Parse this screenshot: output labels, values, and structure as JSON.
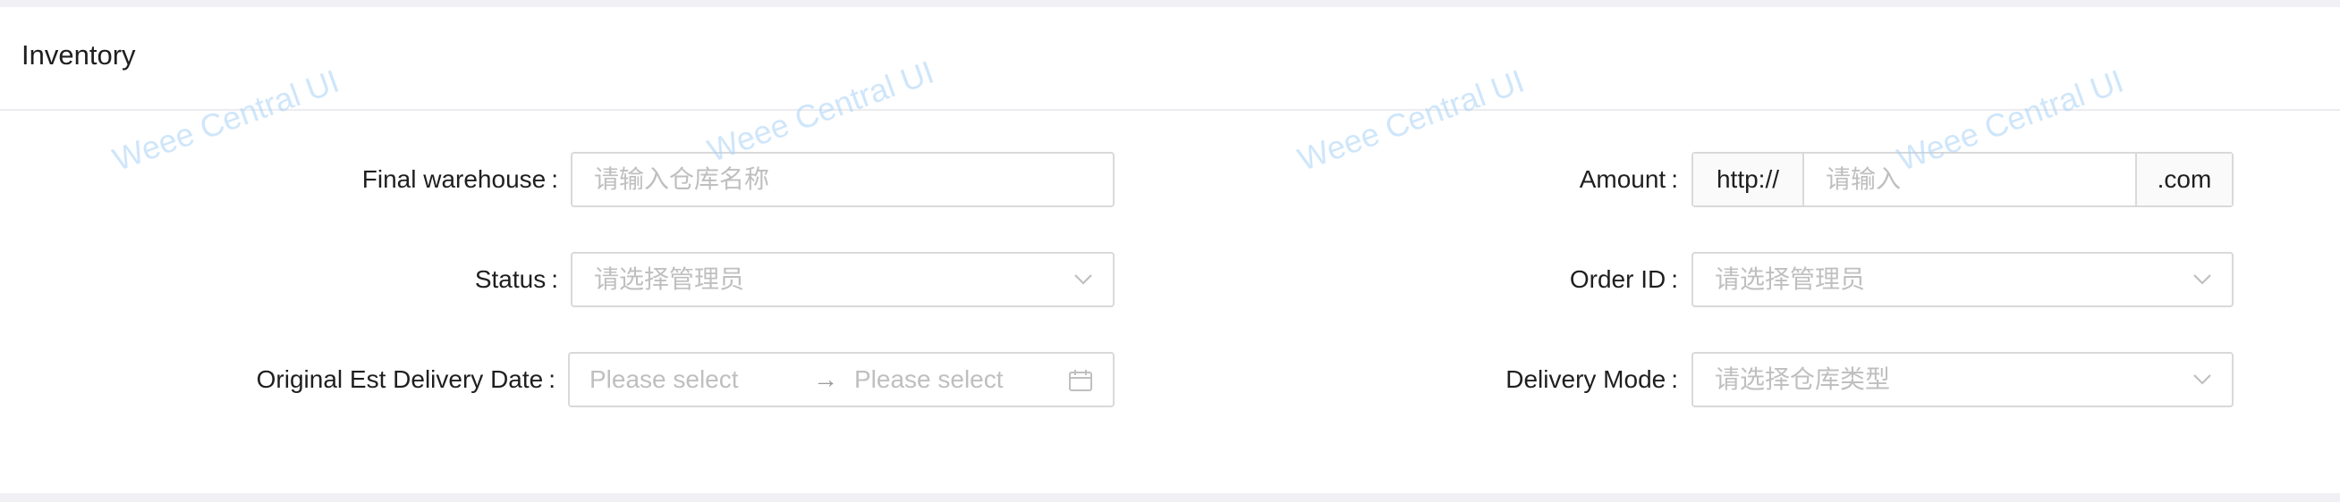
{
  "card": {
    "title": "Inventory"
  },
  "form": {
    "colon": ":",
    "final_warehouse": {
      "label": "Final warehouse",
      "placeholder": "请输入仓库名称"
    },
    "status": {
      "label": "Status",
      "placeholder": "请选择管理员"
    },
    "original_est_delivery_date": {
      "label": "Original Est Delivery Date",
      "start_placeholder": "Please select",
      "separator": "→",
      "end_placeholder": "Please select"
    },
    "amount": {
      "label": "Amount",
      "prefix": "http://",
      "placeholder": "请输入",
      "suffix": ".com"
    },
    "order_id": {
      "label": "Order ID",
      "placeholder": "请选择管理员"
    },
    "delivery_mode": {
      "label": "Delivery Mode",
      "placeholder": "请选择仓库类型"
    }
  },
  "watermark": {
    "text": "Weee Central UI"
  },
  "icons": {
    "select_arrow": "chevron-down-icon",
    "date": "calendar-icon"
  }
}
